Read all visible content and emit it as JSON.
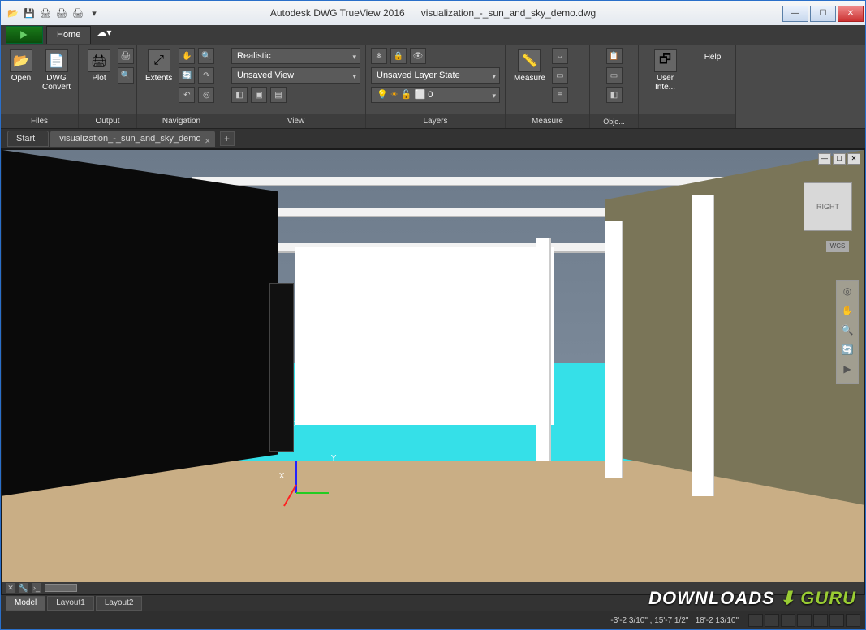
{
  "title": {
    "app": "Autodesk DWG TrueView 2016",
    "file": "visualization_-_sun_and_sky_demo.dwg"
  },
  "tabs": {
    "home": "Home"
  },
  "ribbon": {
    "files": {
      "title": "Files",
      "open": "Open",
      "dwg_convert": "DWG\nConvert"
    },
    "output": {
      "title": "Output",
      "plot": "Plot"
    },
    "navigation": {
      "title": "Navigation",
      "extents": "Extents"
    },
    "view": {
      "title": "View",
      "visual_style": "Realistic",
      "saved_view": "Unsaved View"
    },
    "layers": {
      "title": "Layers",
      "state": "Unsaved Layer State",
      "current": "0"
    },
    "measure": {
      "title": "Measure",
      "measure": "Measure"
    },
    "obj": {
      "label": "Obje..."
    },
    "ui": {
      "label": "User Inte..."
    },
    "help": {
      "label": "Help"
    }
  },
  "doc_tabs": {
    "start": "Start",
    "file": "visualization_-_sun_and_sky_demo"
  },
  "viewcube": {
    "face": "RIGHT",
    "wcs": "WCS"
  },
  "ucs": {
    "z": "Z",
    "y": "Y",
    "x": "X"
  },
  "bottom_tabs": {
    "model": "Model",
    "layout1": "Layout1",
    "layout2": "Layout2"
  },
  "status": {
    "coords": "-3'-2 3/10\" , 15'-7 1/2\" , 18'-2 13/10\""
  },
  "watermark": {
    "t1": "DOWNLOADS",
    "t2": "GURU"
  }
}
